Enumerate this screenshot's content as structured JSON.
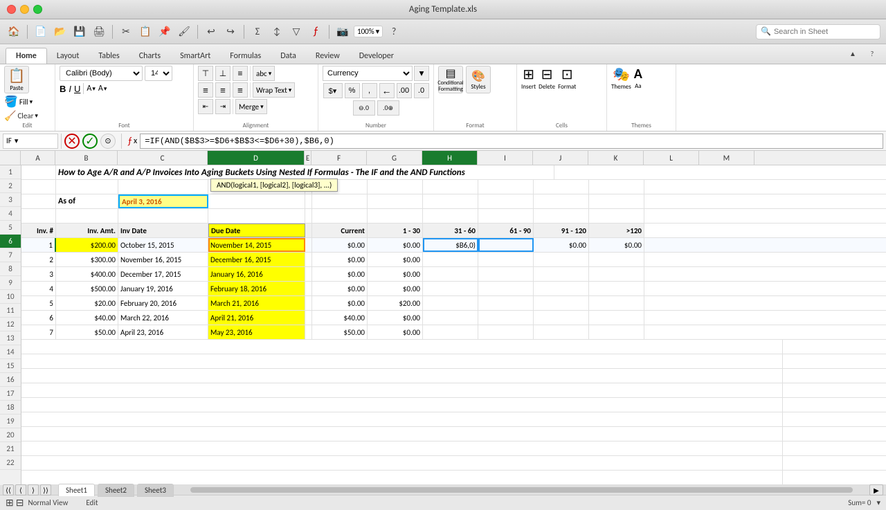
{
  "window": {
    "title": "Aging Template.xls"
  },
  "tabs": {
    "items": [
      "Home",
      "Layout",
      "Tables",
      "Charts",
      "SmartArt",
      "Formulas",
      "Data",
      "Review",
      "Developer"
    ],
    "active": "Home"
  },
  "ribbon": {
    "edit_label": "Edit",
    "font_label": "Font",
    "alignment_label": "Alignment",
    "number_label": "Number",
    "format_label": "Format",
    "cells_label": "Cells",
    "themes_label": "Themes",
    "paste_label": "Paste",
    "fill_label": "Fill",
    "clear_label": "Clear",
    "font_name": "Calibri (Body)",
    "font_size": "14",
    "wrap_text_label": "Wrap Text",
    "currency_label": "Currency",
    "merge_label": "Merge",
    "conditional_label": "Conditional Formatting",
    "styles_label": "Styles",
    "insert_label": "Insert",
    "delete_label": "Delete",
    "format_btn_label": "Format",
    "themes_btn_label": "Themes",
    "abc_label": "abc",
    "bold_label": "B",
    "italic_label": "I",
    "underline_label": "U",
    "align_left": "≡",
    "align_center": "≡",
    "align_right": "≡"
  },
  "formula_bar": {
    "cell_ref": "IF",
    "formula": "=IF(AND($B$3>=$D6+$B$3<=$D6+30),$B6,0)"
  },
  "sheet": {
    "title_row": "How to Age A/R and A/P Invoices Into Aging Buckets Using Nested If Formulas - The IF and the AND Functions",
    "as_of_label": "As of",
    "as_of_date": "April 3, 2016",
    "col_headers": [
      "A",
      "B",
      "C",
      "D",
      "E",
      "F",
      "G",
      "H",
      "I",
      "J",
      "K",
      "L",
      "M"
    ],
    "headers": {
      "a": "Inv. #",
      "b": "Inv. Amt.",
      "c": "Inv Date",
      "d": "Due Date",
      "f": "Current",
      "g": "1 - 30",
      "h": "31 - 60",
      "i": "61 - 90",
      "j": "91 - 120",
      "k": ">120"
    },
    "rows": [
      {
        "num": "1",
        "a": "",
        "b": "",
        "c": "",
        "d": "",
        "f": "",
        "g": "",
        "h": "",
        "i": "",
        "j": "",
        "k": ""
      },
      {
        "num": "2",
        "a": "",
        "b": "",
        "c": "",
        "d": "",
        "f": "",
        "g": "",
        "h": "",
        "i": "",
        "j": "",
        "k": ""
      },
      {
        "num": "3",
        "a": "",
        "b": "",
        "c": "",
        "d": "",
        "f": "",
        "g": "",
        "h": "",
        "i": "",
        "j": "",
        "k": ""
      },
      {
        "num": "4",
        "a": "",
        "b": "",
        "c": "",
        "d": "",
        "f": "",
        "g": "",
        "h": "",
        "i": "",
        "j": "",
        "k": ""
      },
      {
        "num": "5",
        "a": "Inv. #",
        "b": "Inv. Amt.",
        "c": "Inv Date",
        "d": "Due Date",
        "f": "Current",
        "g": "1 - 30",
        "h": "31 - 60",
        "i": "61 - 90",
        "j": "91 - 120",
        "k": ">120"
      },
      {
        "num": "6",
        "a": "1",
        "b": "$200.00",
        "c": "October 15, 2015",
        "d": "November 14, 2015",
        "f": "$0.00",
        "g": "$0.00",
        "h": "$B6,0)",
        "i": "",
        "j": "$0.00",
        "k": "$0.00"
      },
      {
        "num": "7",
        "a": "2",
        "b": "$300.00",
        "c": "November 16, 2015",
        "d": "December 16, 2015",
        "f": "$0.00",
        "g": "$0.00",
        "h": "",
        "i": "",
        "j": "",
        "k": ""
      },
      {
        "num": "8",
        "a": "3",
        "b": "$400.00",
        "c": "December 17, 2015",
        "d": "January 16, 2016",
        "f": "$0.00",
        "g": "$0.00",
        "h": "",
        "i": "",
        "j": "",
        "k": ""
      },
      {
        "num": "9",
        "a": "4",
        "b": "$500.00",
        "c": "January 19, 2016",
        "d": "February 18, 2016",
        "f": "$0.00",
        "g": "$0.00",
        "h": "",
        "i": "",
        "j": "",
        "k": ""
      },
      {
        "num": "10",
        "a": "5",
        "b": "$20.00",
        "c": "February 20, 2016",
        "d": "March 21, 2016",
        "f": "$0.00",
        "g": "$20.00",
        "h": "",
        "i": "",
        "j": "",
        "k": ""
      },
      {
        "num": "11",
        "a": "6",
        "b": "$40.00",
        "c": "March 22, 2016",
        "d": "April 21, 2016",
        "f": "$40.00",
        "g": "$0.00",
        "h": "",
        "i": "",
        "j": "",
        "k": ""
      },
      {
        "num": "12",
        "a": "7",
        "b": "$50.00",
        "c": "April 23, 2016",
        "d": "May 23, 2016",
        "f": "$50.00",
        "g": "$0.00",
        "h": "",
        "i": "",
        "j": "",
        "k": ""
      },
      {
        "num": "13",
        "a": "",
        "b": "",
        "c": "",
        "d": "",
        "f": "",
        "g": "",
        "h": "",
        "i": "",
        "j": "",
        "k": ""
      },
      {
        "num": "14",
        "a": "",
        "b": "",
        "c": "",
        "d": "",
        "f": "",
        "g": "",
        "h": "",
        "i": "",
        "j": "",
        "k": ""
      },
      {
        "num": "15",
        "a": "",
        "b": "",
        "c": "",
        "d": "",
        "f": "",
        "g": "",
        "h": "",
        "i": "",
        "j": "",
        "k": ""
      },
      {
        "num": "16",
        "a": "",
        "b": "",
        "c": "",
        "d": "",
        "f": "",
        "g": "",
        "h": "",
        "i": "",
        "j": "",
        "k": ""
      },
      {
        "num": "17",
        "a": "",
        "b": "",
        "c": "",
        "d": "",
        "f": "",
        "g": "",
        "h": "",
        "i": "",
        "j": "",
        "k": ""
      },
      {
        "num": "18",
        "a": "",
        "b": "",
        "c": "",
        "d": "",
        "f": "",
        "g": "",
        "h": "",
        "i": "",
        "j": "",
        "k": ""
      },
      {
        "num": "19",
        "a": "",
        "b": "",
        "c": "",
        "d": "",
        "f": "",
        "g": "",
        "h": "",
        "i": "",
        "j": "",
        "k": ""
      },
      {
        "num": "20",
        "a": "",
        "b": "",
        "c": "",
        "d": "",
        "f": "",
        "g": "",
        "h": "",
        "i": "",
        "j": "",
        "k": ""
      },
      {
        "num": "21",
        "a": "",
        "b": "",
        "c": "",
        "d": "",
        "f": "",
        "g": "",
        "h": "",
        "i": "",
        "j": "",
        "k": ""
      },
      {
        "num": "22",
        "a": "",
        "b": "",
        "c": "",
        "d": "",
        "f": "",
        "g": "",
        "h": "",
        "i": "",
        "j": "",
        "k": ""
      }
    ]
  },
  "status_bar": {
    "view_label": "Normal View",
    "edit_label": "Edit",
    "sum_label": "Sum= 0"
  },
  "sheets": {
    "tabs": [
      "Sheet1",
      "Sheet2",
      "Sheet3"
    ],
    "active": "Sheet1"
  },
  "search": {
    "placeholder": "Search in Sheet"
  },
  "tooltip": {
    "text": "AND(logical1, [logical2], [logical3], ...)"
  }
}
